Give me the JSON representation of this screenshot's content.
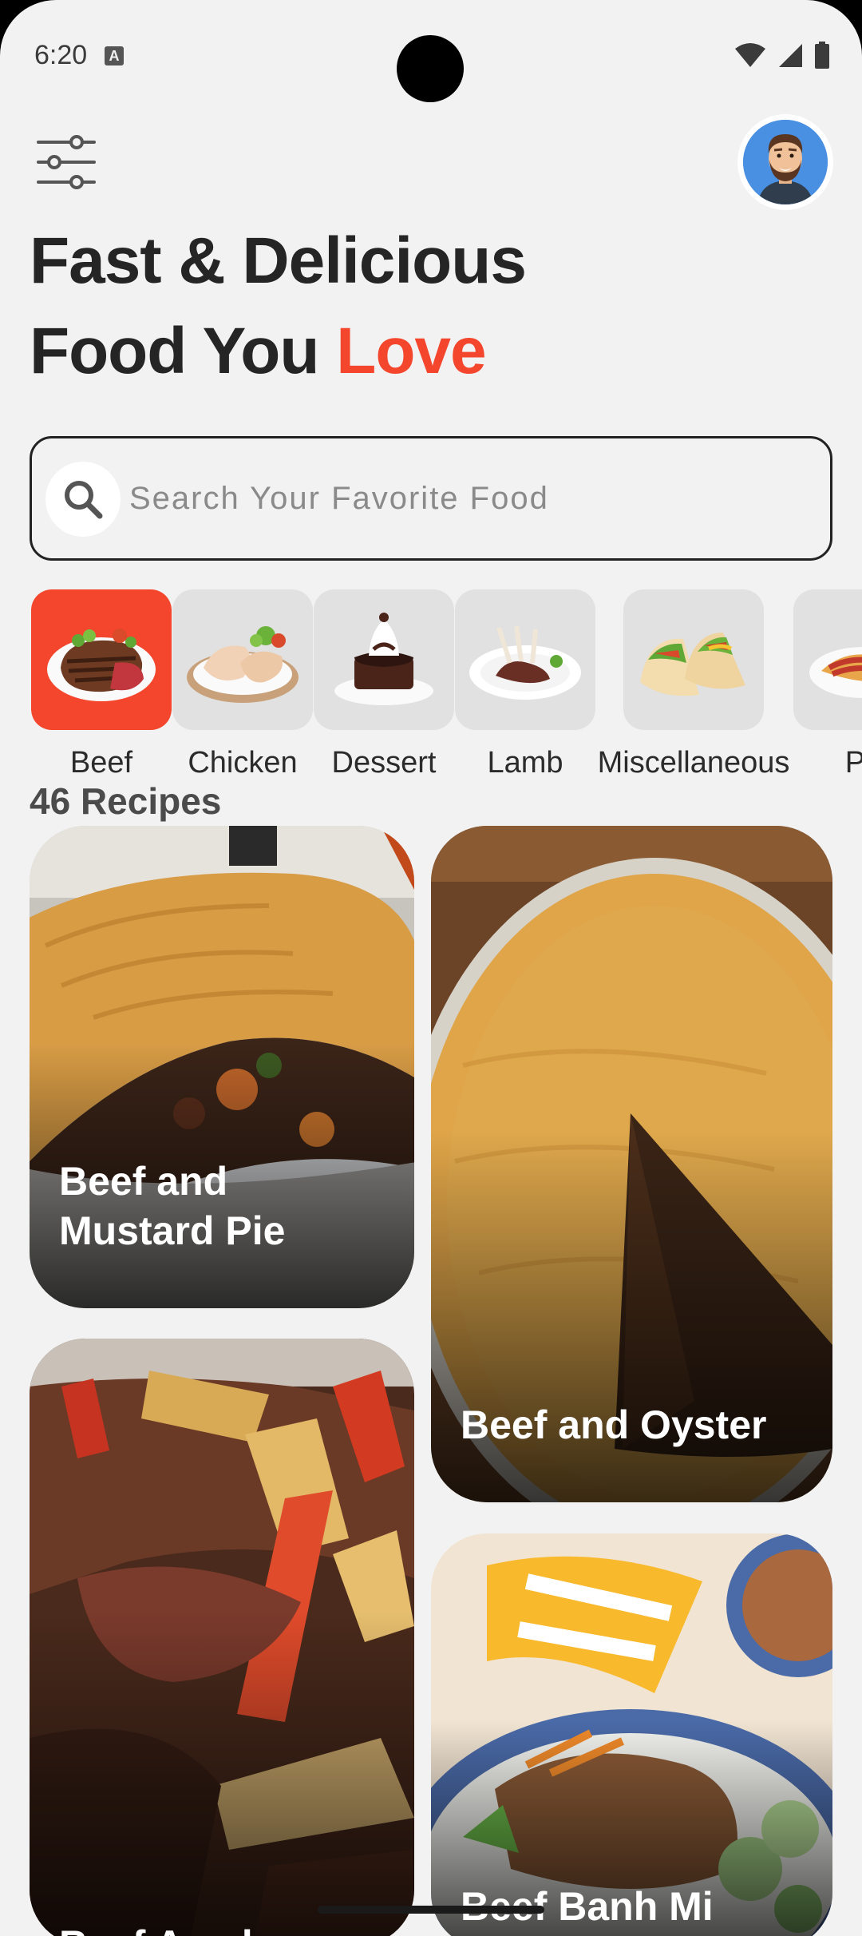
{
  "status_bar": {
    "time": "6:20",
    "badge": "A"
  },
  "header": {
    "headline_line1": "Fast & Delicious",
    "headline_line2_prefix": "Food You ",
    "headline_line2_accent": "Love",
    "accent_color": "#f4452d"
  },
  "search": {
    "placeholder": "Search Your Favorite Food"
  },
  "categories": [
    {
      "label": "Beef",
      "icon": "steak-icon",
      "active": true
    },
    {
      "label": "Chicken",
      "icon": "chicken-icon",
      "active": false
    },
    {
      "label": "Dessert",
      "icon": "cake-icon",
      "active": false
    },
    {
      "label": "Lamb",
      "icon": "lamb-chops-icon",
      "active": false
    },
    {
      "label": "Miscellaneous",
      "icon": "taco-icon",
      "active": false
    },
    {
      "label": "Pa",
      "icon": "pasta-icon",
      "active": false
    }
  ],
  "recipes": {
    "count_label": "46 Recipes",
    "items": [
      {
        "title": "Beef and Mustard Pie"
      },
      {
        "title": "Beef and Oyster"
      },
      {
        "title": "Beef Asado"
      },
      {
        "title": "Beef Banh Mi Bowls w"
      }
    ]
  }
}
